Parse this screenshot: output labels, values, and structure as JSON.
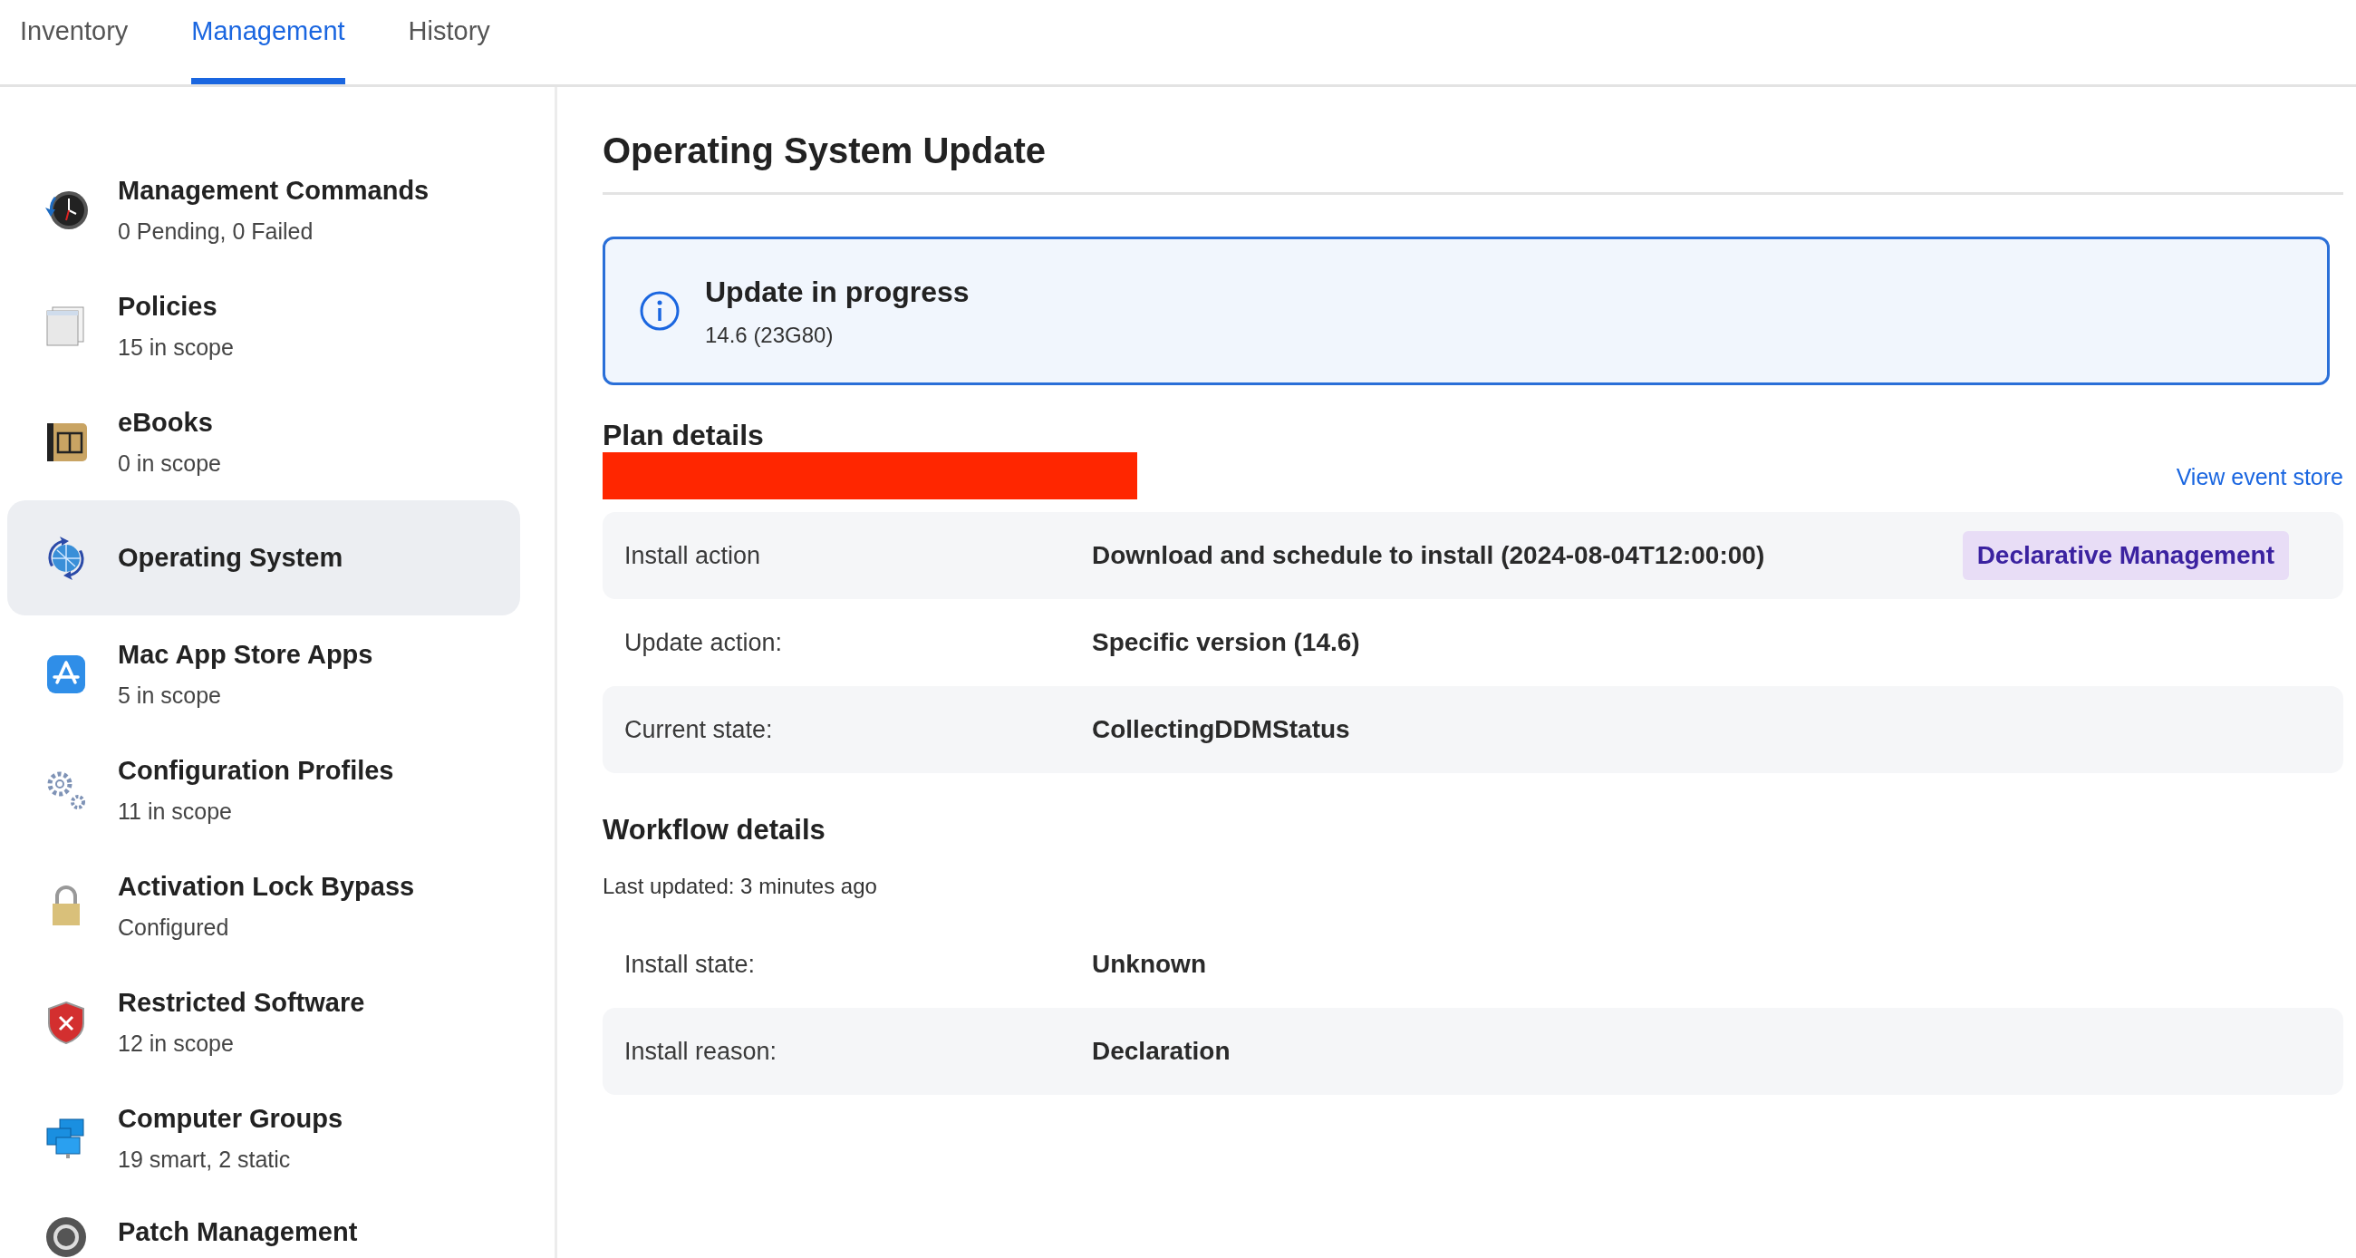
{
  "tabs": [
    {
      "label": "Inventory",
      "selected": false
    },
    {
      "label": "Management",
      "selected": true
    },
    {
      "label": "History",
      "selected": false
    }
  ],
  "sidebar": {
    "items": [
      {
        "title": "Management Commands",
        "subtitle": "0 Pending, 0 Failed",
        "selected": false
      },
      {
        "title": "Policies",
        "subtitle": "15 in scope",
        "selected": false
      },
      {
        "title": "eBooks",
        "subtitle": "0 in scope",
        "selected": false
      },
      {
        "title": "Operating System",
        "selected": true
      },
      {
        "title": "Mac App Store Apps",
        "subtitle": "5 in scope",
        "selected": false
      },
      {
        "title": "Configuration Profiles",
        "subtitle": "11 in scope",
        "selected": false
      },
      {
        "title": "Activation Lock Bypass",
        "subtitle": "Configured",
        "selected": false
      },
      {
        "title": "Restricted Software",
        "subtitle": "12 in scope",
        "selected": false
      },
      {
        "title": "Computer Groups",
        "subtitle": "19 smart, 2 static",
        "selected": false
      },
      {
        "title": "Patch Management",
        "selected": false
      }
    ]
  },
  "main": {
    "title": "Operating System Update",
    "notice": {
      "title": "Update in progress",
      "detail": "14.6 (23G80)"
    },
    "plan": {
      "heading": "Plan details",
      "link": "View event store",
      "rows": [
        {
          "label": "Install action",
          "value": "Download and schedule to install (2024-08-04T12:00:00)",
          "badge": "Declarative Management"
        },
        {
          "label": "Update action:",
          "value": "Specific version (14.6)"
        },
        {
          "label": "Current state:",
          "value": "CollectingDDMStatus"
        }
      ]
    },
    "workflow": {
      "heading": "Workflow details",
      "updated": "Last updated: 3 minutes ago",
      "rows": [
        {
          "label": "Install state:",
          "value": "Unknown"
        },
        {
          "label": "Install reason:",
          "value": "Declaration"
        }
      ]
    }
  }
}
